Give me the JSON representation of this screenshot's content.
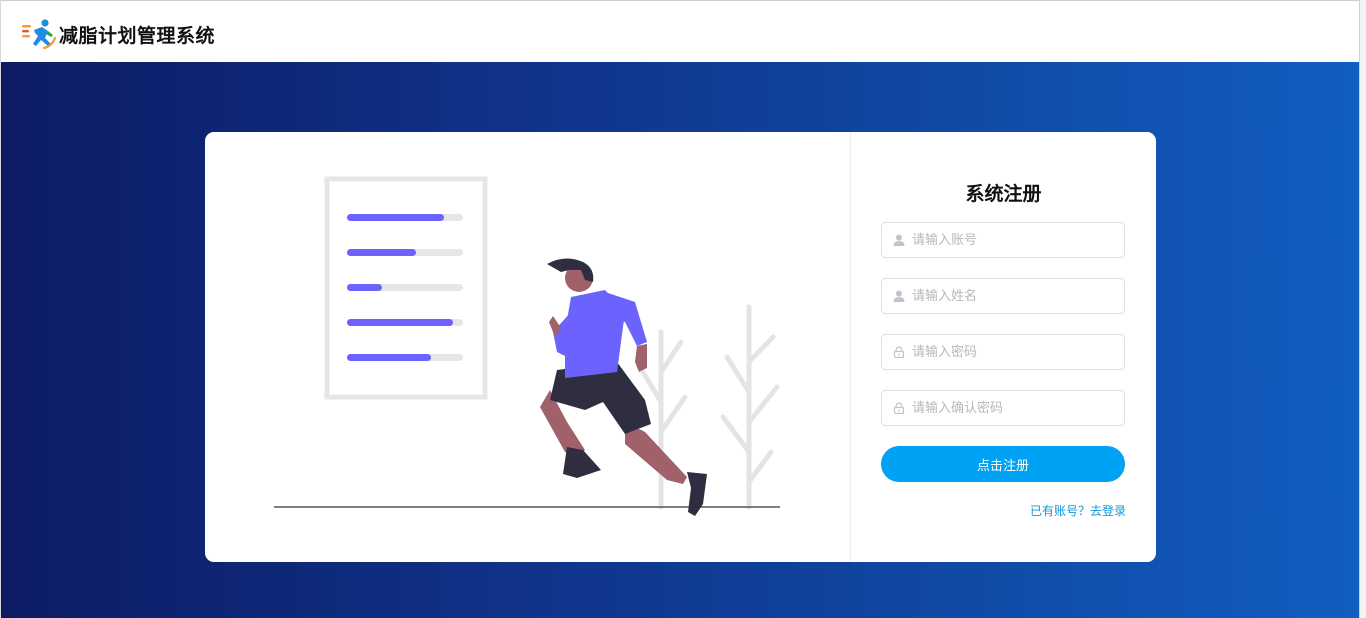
{
  "header": {
    "title": "减脂计划管理系统",
    "logo_icon": "runner-logo-icon"
  },
  "register": {
    "title": "系统注册",
    "fields": [
      {
        "name": "account",
        "placeholder": "请输入账号",
        "icon": "user-icon",
        "value": ""
      },
      {
        "name": "name",
        "placeholder": "请输入姓名",
        "icon": "user-icon",
        "value": ""
      },
      {
        "name": "password",
        "placeholder": "请输入密码",
        "icon": "lock-icon",
        "value": ""
      },
      {
        "name": "confirm_password",
        "placeholder": "请输入确认密码",
        "icon": "lock-icon",
        "value": ""
      }
    ],
    "submit_label": "点击注册",
    "login_link": "已有账号？去登录"
  },
  "colors": {
    "gradient_start": "#0d1b64",
    "gradient_end": "#115ec0",
    "primary_button": "#00a2f3",
    "link": "#1296db",
    "accent_purple": "#6c63ff"
  }
}
